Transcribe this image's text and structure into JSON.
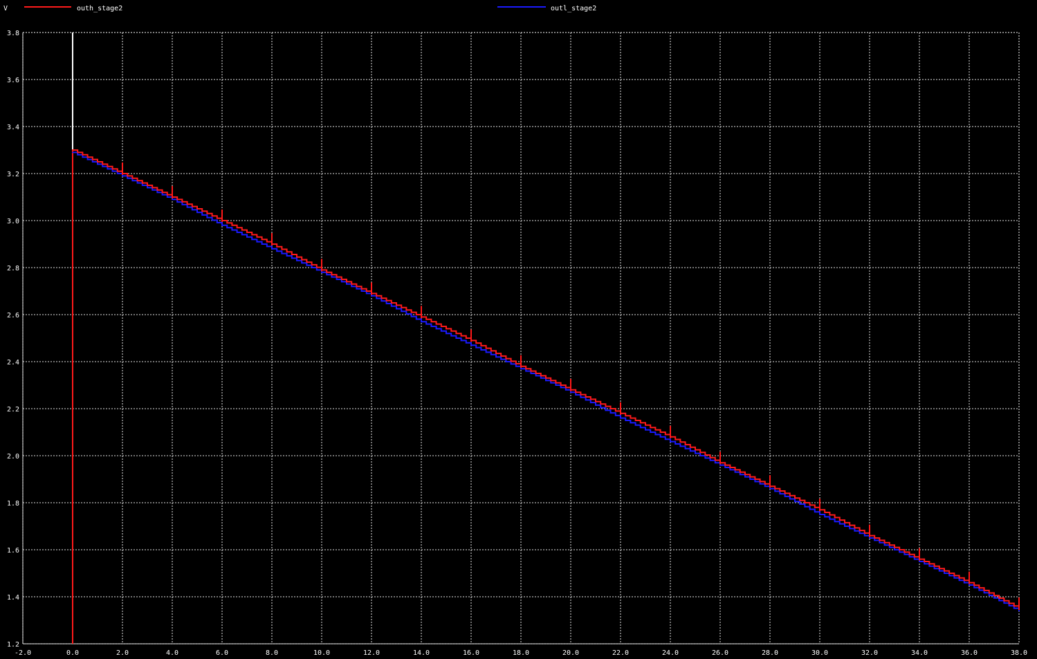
{
  "chart_data": {
    "type": "line",
    "ylabel": "V",
    "xlim": [
      -2.0,
      38.0
    ],
    "ylim": [
      1.2,
      3.8
    ],
    "x_ticks": [
      "-2.0",
      "0.0",
      "2.0",
      "4.0",
      "6.0",
      "8.0",
      "10.0",
      "12.0",
      "14.0",
      "16.0",
      "18.0",
      "20.0",
      "22.0",
      "24.0",
      "26.0",
      "28.0",
      "30.0",
      "32.0",
      "34.0",
      "36.0",
      "38.0"
    ],
    "y_ticks": [
      "1.2",
      "1.4",
      "1.6",
      "1.8",
      "2.0",
      "2.2",
      "2.4",
      "2.6",
      "2.8",
      "3.0",
      "3.2",
      "3.4",
      "3.6",
      "3.8"
    ],
    "grid": true,
    "legend_placement": "top",
    "series": [
      {
        "name": "outh_stage2",
        "color": "#ff1a1a",
        "x": [
          0.0,
          0.0,
          2.0,
          4.0,
          6.0,
          8.0,
          10.0,
          12.0,
          14.0,
          16.0,
          18.0,
          20.0,
          22.0,
          24.0,
          26.0,
          28.0,
          30.0,
          32.0,
          34.0,
          36.0,
          38.0
        ],
        "values": [
          1.2,
          3.3,
          3.2,
          3.1,
          3.0,
          2.9,
          2.79,
          2.69,
          2.59,
          2.49,
          2.38,
          2.28,
          2.18,
          2.08,
          1.97,
          1.87,
          1.77,
          1.66,
          1.56,
          1.46,
          1.35
        ]
      },
      {
        "name": "outl_stage2",
        "color": "#1a1aff",
        "x": [
          0.0,
          2.0,
          4.0,
          6.0,
          8.0,
          10.0,
          12.0,
          14.0,
          16.0,
          18.0,
          20.0,
          22.0,
          24.0,
          26.0,
          28.0,
          30.0,
          32.0,
          34.0,
          36.0,
          38.0
        ],
        "values": [
          3.29,
          3.19,
          3.09,
          2.98,
          2.88,
          2.78,
          2.68,
          2.57,
          2.47,
          2.37,
          2.27,
          2.16,
          2.06,
          1.96,
          1.86,
          1.75,
          1.65,
          1.55,
          1.45,
          1.34
        ]
      }
    ],
    "cursor": {
      "x": 0.0,
      "color": "#ffffff"
    }
  }
}
